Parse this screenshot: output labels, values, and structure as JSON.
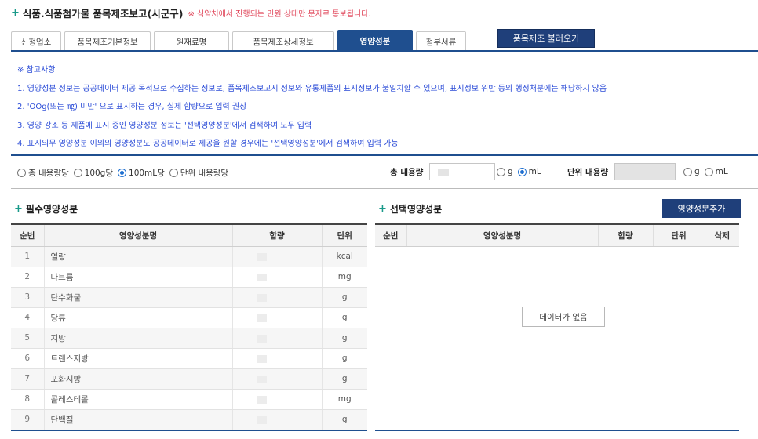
{
  "header": {
    "title": "식품.식품첨가물 품목제조보고(시군구)",
    "note": "※ 식약처에서 진행되는 민원 상태만 문자로 통보됩니다."
  },
  "tabs": [
    {
      "label": "신청업소",
      "active": false
    },
    {
      "label": "품목제조기본정보",
      "active": false
    },
    {
      "label": "원재료명",
      "active": false
    },
    {
      "label": "품목제조상세정보",
      "active": false
    },
    {
      "label": "영양성분",
      "active": true
    },
    {
      "label": "첨부서류",
      "active": false
    }
  ],
  "load_button": "품목제조 불러오기",
  "notes": [
    "※ 참고사항",
    "1. 영양성분 정보는 공공데이터 제공 목적으로 수집하는 정보로, 품목제조보고시 정보와 유통제품의 표시정보가 불일치할 수 있으며, 표시정보 위반 등의 행정처분에는 해당하지 않음",
    "2. 'OOg(또는 ㎎) 미만' 으로 표시하는 경우, 실제 함량으로 입력 권장",
    "3. 영양 강조 등 제품에 표시 중인 영양성분 정보는 '선택영양성분'에서 검색하여 모두 입력",
    "4. 표시의무 영양성분 이외의 영양성분도 공공데이터로 제공을 원할 경우에는 '선택영양성분'에서 검색하여 입력 가능"
  ],
  "basis_options": [
    {
      "label": "총 내용량당",
      "selected": false
    },
    {
      "label": "100g당",
      "selected": false
    },
    {
      "label": "100mL당",
      "selected": true
    },
    {
      "label": "단위 내용량당",
      "selected": false
    }
  ],
  "total_content": {
    "label": "총 내용량",
    "units": [
      {
        "label": "g",
        "selected": false
      },
      {
        "label": "mL",
        "selected": true
      }
    ]
  },
  "unit_content": {
    "label": "단위 내용량",
    "units": [
      {
        "label": "g",
        "selected": false
      },
      {
        "label": "mL",
        "selected": false
      }
    ]
  },
  "required": {
    "title": "필수영양성분",
    "headers": [
      "순번",
      "영양성분명",
      "함량",
      "단위"
    ],
    "rows": [
      {
        "no": "1",
        "name": "열량",
        "unit": "kcal"
      },
      {
        "no": "2",
        "name": "나트륨",
        "unit": "mg"
      },
      {
        "no": "3",
        "name": "탄수화물",
        "unit": "g"
      },
      {
        "no": "4",
        "name": "당류",
        "unit": "g"
      },
      {
        "no": "5",
        "name": "지방",
        "unit": "g"
      },
      {
        "no": "6",
        "name": "트랜스지방",
        "unit": "g"
      },
      {
        "no": "7",
        "name": "포화지방",
        "unit": "g"
      },
      {
        "no": "8",
        "name": "콜레스테롤",
        "unit": "mg"
      },
      {
        "no": "9",
        "name": "단백질",
        "unit": "g"
      }
    ]
  },
  "optional": {
    "title": "선택영양성분",
    "add_button": "영양성분추가",
    "headers": [
      "순번",
      "영양성분명",
      "함량",
      "단위",
      "삭제"
    ],
    "empty_text": "데이터가 없음"
  },
  "colors": {
    "accent": "#1f4f8f",
    "button": "#1f3f7a",
    "note_text": "#2a4bd7",
    "warning_text": "#e0465a",
    "plus_icon": "#1a9a8a"
  }
}
